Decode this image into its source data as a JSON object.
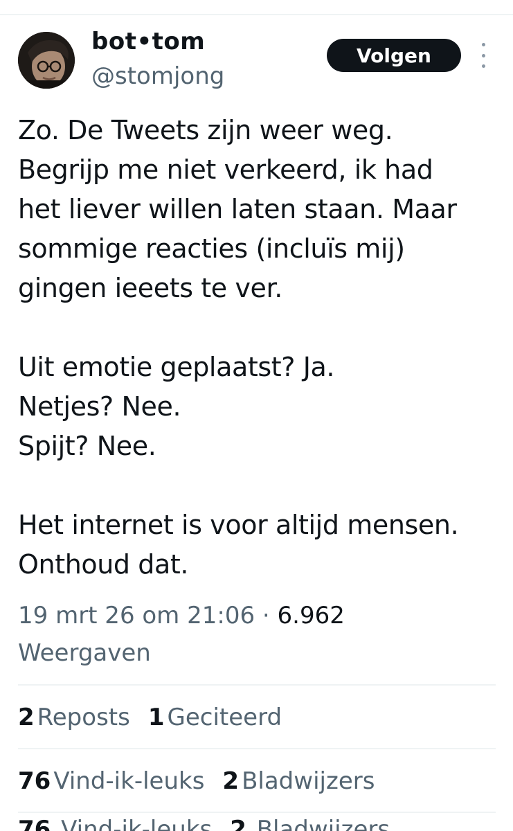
{
  "author": {
    "display_name": "bot•tom",
    "handle": "@stomjong",
    "avatar_icon": "user-avatar"
  },
  "follow_label": "Volgen",
  "more_icon": "more-vertical-icon",
  "tweet": {
    "lines": [
      "Zo. De Tweets zijn weer weg.",
      "Begrijp me niet verkeerd, ik had",
      "het liever willen laten staan. Maar",
      "sommige reacties (incluïs mij)",
      "gingen ieeets te ver.",
      "",
      "Uit emotie geplaatst? Ja.",
      "Netjes? Nee.",
      "Spijt? Nee.",
      "",
      "Het internet is voor altijd mensen.",
      "Onthoud dat."
    ]
  },
  "meta": {
    "timestamp": "19 mrt 26 om 21:06",
    "separator": " · ",
    "views_count": "6.962",
    "views_label": "Weergaven"
  },
  "stats": {
    "reposts_count": "2",
    "reposts_label": "Reposts",
    "quotes_count": "1",
    "quotes_label": "Geciteerd",
    "likes_count": "76",
    "likes_label": "Vind-ik-leuks",
    "bookmarks_count": "2",
    "bookmarks_label": "Bladwijzers"
  },
  "colors": {
    "text_primary": "#0f1419",
    "text_secondary": "#536471",
    "divider": "#eff3f4",
    "button_bg": "#0f1419",
    "button_text": "#ffffff"
  }
}
